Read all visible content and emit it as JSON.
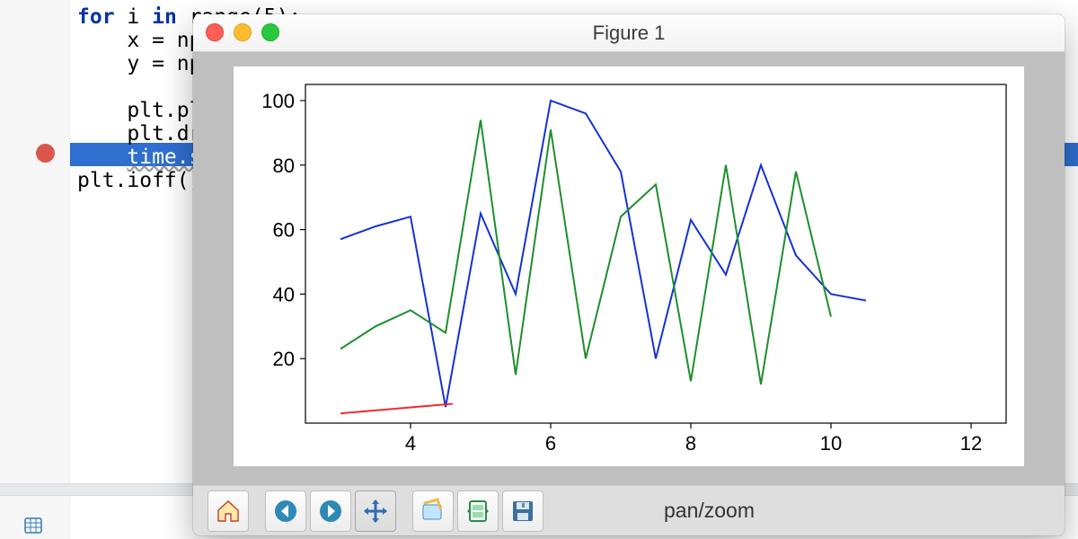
{
  "editor": {
    "lines": [
      {
        "indent": 0,
        "parts": [
          {
            "t": "for ",
            "c": "kw"
          },
          {
            "t": "i "
          },
          {
            "t": "in ",
            "c": "kw"
          },
          {
            "t": "range(5):"
          }
        ]
      },
      {
        "indent": 1,
        "parts": [
          {
            "t": "x = np.a"
          }
        ]
      },
      {
        "indent": 1,
        "parts": [
          {
            "t": "y = np.ra"
          }
        ]
      },
      {
        "indent": 1,
        "parts": [
          {
            "t": ""
          }
        ]
      },
      {
        "indent": 1,
        "parts": [
          {
            "t": "plt.plot"
          }
        ]
      },
      {
        "indent": 1,
        "parts": [
          {
            "t": "plt.draw"
          }
        ]
      },
      {
        "indent": 1,
        "parts": [
          {
            "t": "time.slee",
            "c": "hl-text"
          }
        ],
        "highlight": true
      },
      {
        "indent": 0,
        "parts": [
          {
            "t": ""
          }
        ]
      },
      {
        "indent": 0,
        "parts": [
          {
            "t": "plt.ioff()"
          }
        ]
      }
    ]
  },
  "figure": {
    "title": "Figure 1",
    "toolbar_status": "pan/zoom"
  },
  "chart_data": {
    "type": "line",
    "x_ticks": [
      4,
      6,
      8,
      10,
      12
    ],
    "y_ticks": [
      20,
      40,
      60,
      80,
      100
    ],
    "xlim": [
      2.5,
      12.5
    ],
    "ylim": [
      0,
      105
    ],
    "series": [
      {
        "name": "blue",
        "color": "#1433d6",
        "x": [
          3,
          3.5,
          4,
          4.5,
          5,
          5.5,
          6,
          6.5,
          7,
          7.5,
          8,
          8.5,
          9,
          9.5,
          10,
          10.5
        ],
        "y": [
          57,
          61,
          64,
          5,
          65,
          40,
          100,
          96,
          78,
          20,
          63,
          46,
          80,
          52,
          40,
          38
        ]
      },
      {
        "name": "green",
        "color": "#1e8f2b",
        "x": [
          3,
          3.5,
          4,
          4.5,
          5,
          5.5,
          6,
          6.5,
          7,
          7.5,
          8,
          8.5,
          9,
          9.5,
          10
        ],
        "y": [
          23,
          30,
          35,
          28,
          94,
          15,
          91,
          20,
          64,
          74,
          13,
          80,
          12,
          78,
          33
        ]
      },
      {
        "name": "red",
        "color": "#ef2a2a",
        "x": [
          3,
          4.6
        ],
        "y": [
          3,
          6
        ]
      }
    ]
  },
  "colors": {
    "traffic_close": "#ff5f56",
    "traffic_min": "#ffbd2e",
    "traffic_max": "#27c93f"
  }
}
